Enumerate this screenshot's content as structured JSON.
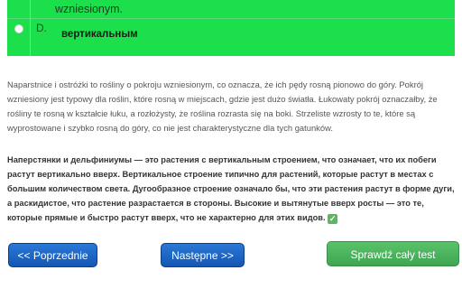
{
  "answer_option": {
    "prev_text": "wzniesionym.",
    "letter": "D.",
    "text": "вертикальным"
  },
  "explanation_pl": "Naparstnice i ostróżki to rośliny o pokroju wzniesionym, co oznacza, że ich pędy rosną pionowo do góry. Pokrój wzniesiony jest typowy dla roślin, które rosną w miejscach, gdzie jest dużo światła. Łukowaty pokrój oznaczałby, że rośliny te rosną w kształcie łuku, a rozłożysty, że roślina rozrasta się na boki. Strzeliste wzrosty to te, które są wyprostowane i szybko rosną do góry, co nie jest charakterystyczne dla tych gatunków.",
  "explanation_ru": "Наперстянки и дельфиниумы — это растения с вертикальным строением, что означает, что их побеги растут вертикально вверх. Вертикальное строение типично для растений, которые растут в местах с большим количеством света. Дугообразное строение означало бы, что эти растения растут в форме дуги, а раскидистое, что растение разрастается в стороны. Высокие и вытянутые вверх росты — это те, которые прямые и быстро растут вверх, что не характерно для этих видов.",
  "buttons": {
    "prev": "<< Poprzednie",
    "next": "Następne >>",
    "check": "Sprawdź cały test"
  },
  "colors": {
    "correct_answer_bg": "#1be04b",
    "nav_button": "#1a62c2",
    "check_button": "#4cb45d"
  }
}
